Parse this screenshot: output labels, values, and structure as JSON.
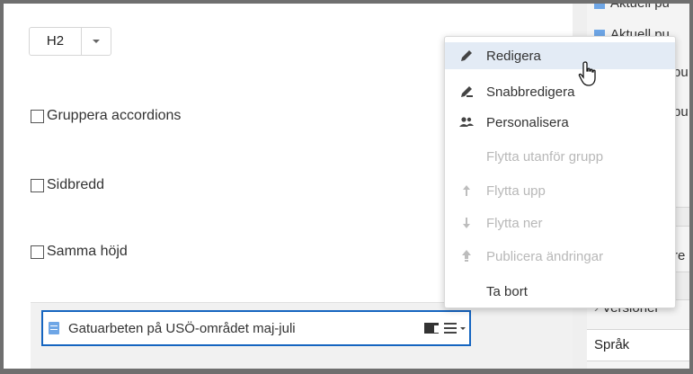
{
  "heading_select": {
    "value": "H2"
  },
  "checkboxes": [
    {
      "label": "Gruppera accordions",
      "checked": false
    },
    {
      "label": "Sidbredd",
      "checked": false
    },
    {
      "label": "Samma höjd",
      "checked": false
    }
  ],
  "selected_block": {
    "label": "Gatuarbeten på USÖ-området maj-juli",
    "icon": "page-icon"
  },
  "right_panel": {
    "items": [
      "Aktuell pu",
      "Aktuell pu",
      "pu",
      "pu"
    ],
    "partial_re": "re",
    "versioner": "Versioner",
    "sprak": "Språk"
  },
  "context_menu": {
    "items": [
      {
        "label": "Redigera",
        "icon": "pencil-icon",
        "enabled": true,
        "highlighted": true
      },
      {
        "label": "Snabbredigera",
        "icon": "quick-edit-icon",
        "enabled": true
      },
      {
        "label": "Personalisera",
        "icon": "people-icon",
        "enabled": true
      },
      {
        "label": "Flytta utanför grupp",
        "icon": "",
        "enabled": false
      },
      {
        "label": "Flytta upp",
        "icon": "arrow-up-icon",
        "enabled": false
      },
      {
        "label": "Flytta ner",
        "icon": "arrow-down-icon",
        "enabled": false
      },
      {
        "label": "Publicera ändringar",
        "icon": "publish-icon",
        "enabled": false
      },
      {
        "label": "Ta bort",
        "icon": "",
        "enabled": true
      }
    ]
  },
  "colors": {
    "accent": "#1565c0",
    "highlight": "#e3ebf5",
    "page_icon": "#6ea6e6",
    "disabled_text": "#b8b8b8"
  }
}
